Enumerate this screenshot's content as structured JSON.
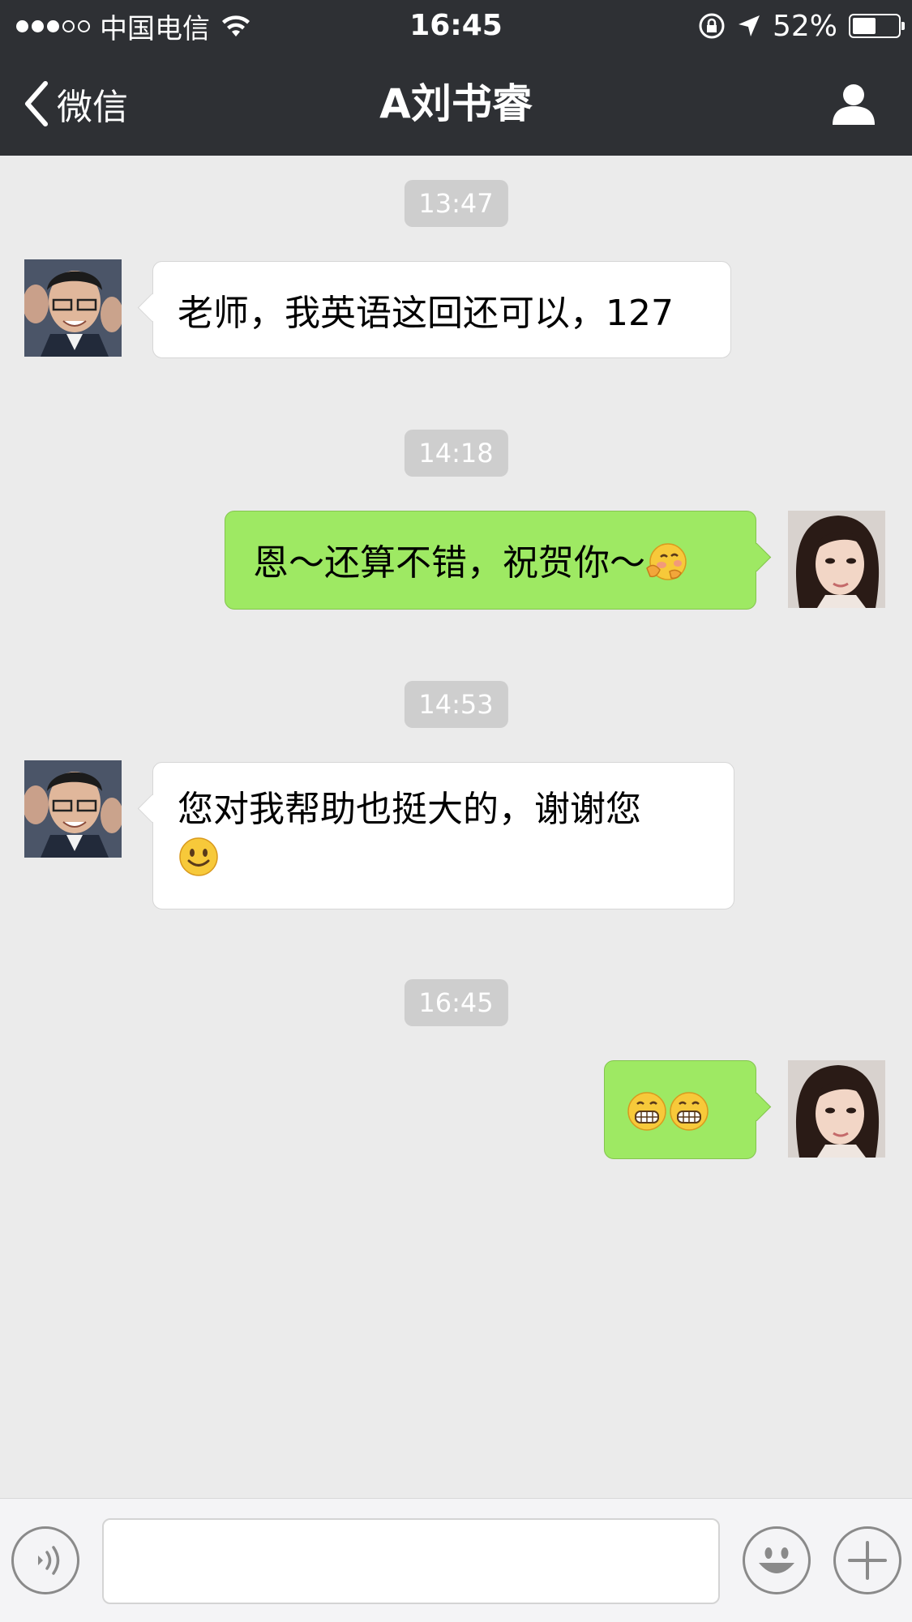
{
  "status_bar": {
    "carrier": "中国电信",
    "time": "16:45",
    "battery_text": "52%",
    "battery_level": 0.52,
    "signal_bars_filled": 3,
    "signal_bars_total": 5
  },
  "nav": {
    "back_label": "微信",
    "title": "A刘书睿",
    "icons": {
      "back": "chevron-left-icon",
      "profile": "person-icon"
    }
  },
  "messages": [
    {
      "timestamp": "13:47",
      "direction": "incoming",
      "text": "老师，我英语这回还可以，127",
      "emoji": []
    },
    {
      "timestamp": "14:18",
      "direction": "outgoing",
      "text": "恩～还算不错，祝贺你～",
      "emoji": [
        "hug-emoji"
      ]
    },
    {
      "timestamp": "14:53",
      "direction": "incoming",
      "text": "您对我帮助也挺大的，谢谢您",
      "emoji": [
        "smile-emoji"
      ]
    },
    {
      "timestamp": "16:45",
      "direction": "outgoing",
      "text": "",
      "emoji": [
        "grin-emoji",
        "grin-emoji"
      ]
    }
  ],
  "input_bar": {
    "text_value": "",
    "icons": {
      "voice": "voice-icon",
      "emoji": "emoji-icon",
      "more": "plus-icon"
    }
  },
  "colors": {
    "nav_bg": "#2e3034",
    "chat_bg": "#ebebeb",
    "outgoing_bubble": "#9ee963",
    "incoming_bubble": "#ffffff",
    "timestamp_bg": "#cecece"
  }
}
